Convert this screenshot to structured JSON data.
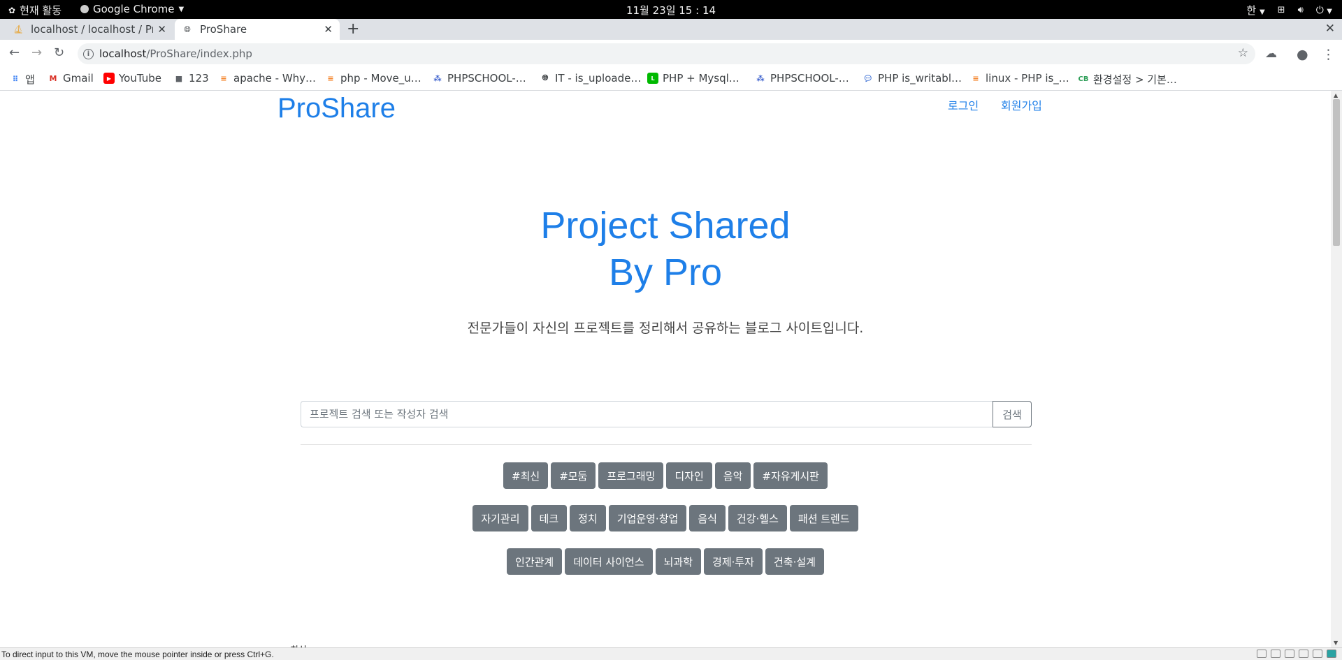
{
  "topbar": {
    "activities": "현재 활동",
    "app_name": "Google Chrome",
    "clock": "11월 23일  15 : 14",
    "input_method": "한"
  },
  "tabs": [
    {
      "title": "localhost / localhost / Pro",
      "active": false
    },
    {
      "title": "ProShare",
      "active": true
    }
  ],
  "toolbar": {
    "url_host": "localhost",
    "url_path": "/ProShare/index.php"
  },
  "bookmarks": [
    {
      "label": "앱",
      "icon": "apps-grid-icon"
    },
    {
      "label": "Gmail",
      "icon": "gmail-icon"
    },
    {
      "label": "YouTube",
      "icon": "youtube-icon"
    },
    {
      "label": "123",
      "icon": "folder-icon"
    },
    {
      "label": "apache - Why…",
      "icon": "stackoverflow-icon"
    },
    {
      "label": "php - Move_u…",
      "icon": "stackoverflow-icon"
    },
    {
      "label": "PHPSCHOOL-…",
      "icon": "phpschool-icon"
    },
    {
      "label": "IT - is_uploade…",
      "icon": "globe-icon"
    },
    {
      "label": "PHP + Mysql…",
      "icon": "line-icon"
    },
    {
      "label": "PHPSCHOOL-…",
      "icon": "phpschool-icon"
    },
    {
      "label": "PHP is_writabl…",
      "icon": "chat-icon"
    },
    {
      "label": "linux - PHP is_…",
      "icon": "stackoverflow-icon"
    },
    {
      "label": "환경설정 > 기본…",
      "icon": "cb-icon"
    }
  ],
  "page": {
    "brand": "ProShare",
    "nav": {
      "login": "로그인",
      "signup": "회원가입"
    },
    "hero": {
      "line1": "Project Shared",
      "line2": "By Pro"
    },
    "subtitle": "전문가들이 자신의 프로젝트를 정리해서 공유하는 블로그 사이트입니다.",
    "search": {
      "placeholder": "프로젝트 검색 또는 작성자 검색",
      "button": "검색"
    },
    "tag_rows": [
      [
        "#최신",
        "#모둠",
        "프로그래밍",
        "디자인",
        "음악",
        "#자유게시판"
      ],
      [
        "자기관리",
        "테크",
        "정치",
        "기업운영·창업",
        "음식",
        "건강·헬스",
        "패션 트렌드"
      ],
      [
        "인간관계",
        "데이터 사이언스",
        "뇌과학",
        "경제·투자",
        "건축·설계"
      ]
    ],
    "clipped_text": "최신"
  },
  "vm_status": "To direct input to this VM, move the mouse pointer inside or press Ctrl+G.",
  "colors": {
    "accent": "#1e7fe8",
    "tag_bg": "#6c757d"
  }
}
